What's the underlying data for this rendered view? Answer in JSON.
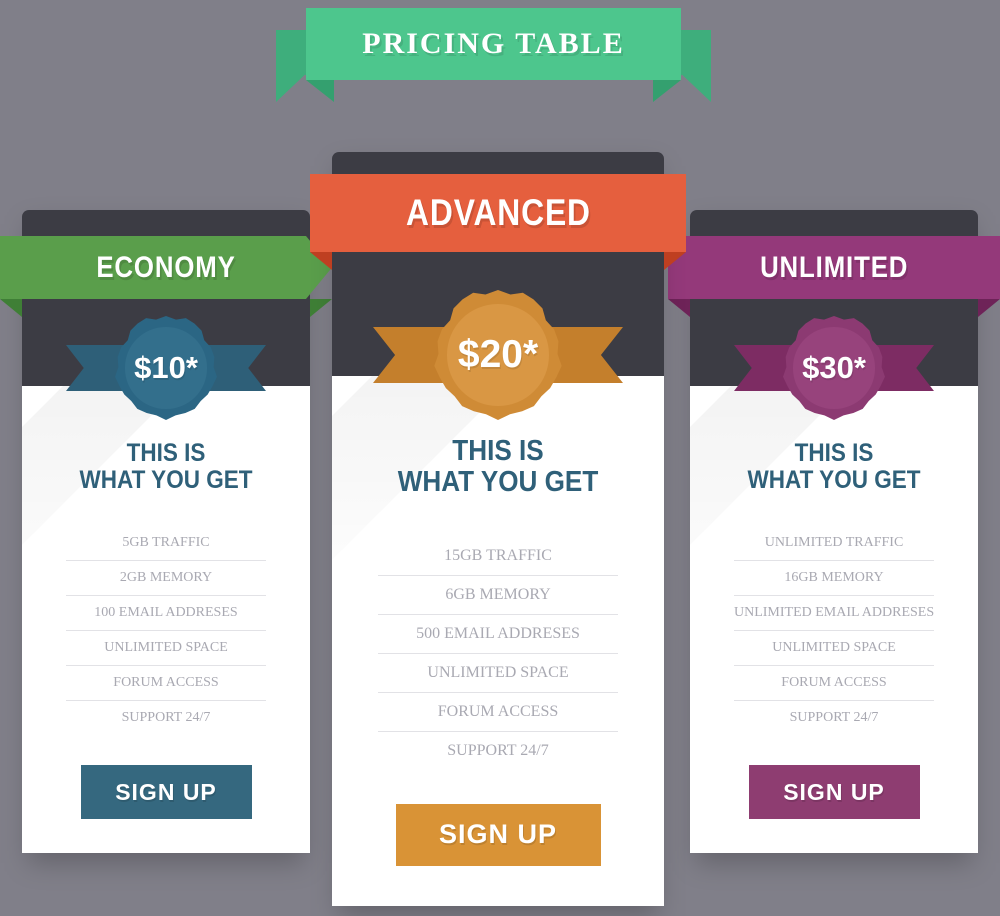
{
  "banner": {
    "title": "PRICING TABLE",
    "color": "#4dc68d",
    "fold_color": "#34a06f"
  },
  "common": {
    "headline_line1": "THIS IS",
    "headline_line2": "WHAT YOU GET",
    "headline_color": "#2f6079",
    "signup_label": "SIGN UP"
  },
  "plans": [
    {
      "id": "economy",
      "name": "ECONOMY",
      "price": "$10*",
      "ribbon_color": "#5a9e4b",
      "ribbon_fold_color": "#3f7f36",
      "badge_color": "#2b6684",
      "button_color": "#35687f",
      "headline_line1": "THIS IS",
      "headline_line2": "WHAT YOU GET",
      "signup_label": "SIGN UP",
      "features": [
        "5GB TRAFFIC",
        "2GB MEMORY",
        "100 EMAIL ADDRESES",
        "UNLIMITED SPACE",
        "FORUM ACCESS",
        "SUPPORT 24/7"
      ]
    },
    {
      "id": "advanced",
      "name": "ADVANCED",
      "price": "$20*",
      "ribbon_color": "#e55f3e",
      "ribbon_fold_color": "#bf3f21",
      "badge_color": "#cf8b36",
      "button_color": "#d99336",
      "headline_line1": "THIS IS",
      "headline_line2": "WHAT YOU GET",
      "signup_label": "SIGN UP",
      "features": [
        "15GB TRAFFIC",
        "6GB MEMORY",
        "500 EMAIL ADDRESES",
        "UNLIMITED SPACE",
        "FORUM ACCESS",
        "SUPPORT 24/7"
      ]
    },
    {
      "id": "unlimited",
      "name": "UNLIMITED",
      "price": "$30*",
      "ribbon_color": "#94397a",
      "ribbon_fold_color": "#6e2358",
      "badge_color": "#8c3a72",
      "button_color": "#8e3d71",
      "headline_line1": "THIS IS",
      "headline_line2": "WHAT YOU GET",
      "signup_label": "SIGN UP",
      "features": [
        "UNLIMITED TRAFFIC",
        "16GB MEMORY",
        "UNLIMITED EMAIL ADDRESES",
        "UNLIMITED SPACE",
        "FORUM ACCESS",
        "SUPPORT 24/7"
      ]
    }
  ],
  "background_color": "#807f89",
  "card_header_color": "#3c3c44"
}
